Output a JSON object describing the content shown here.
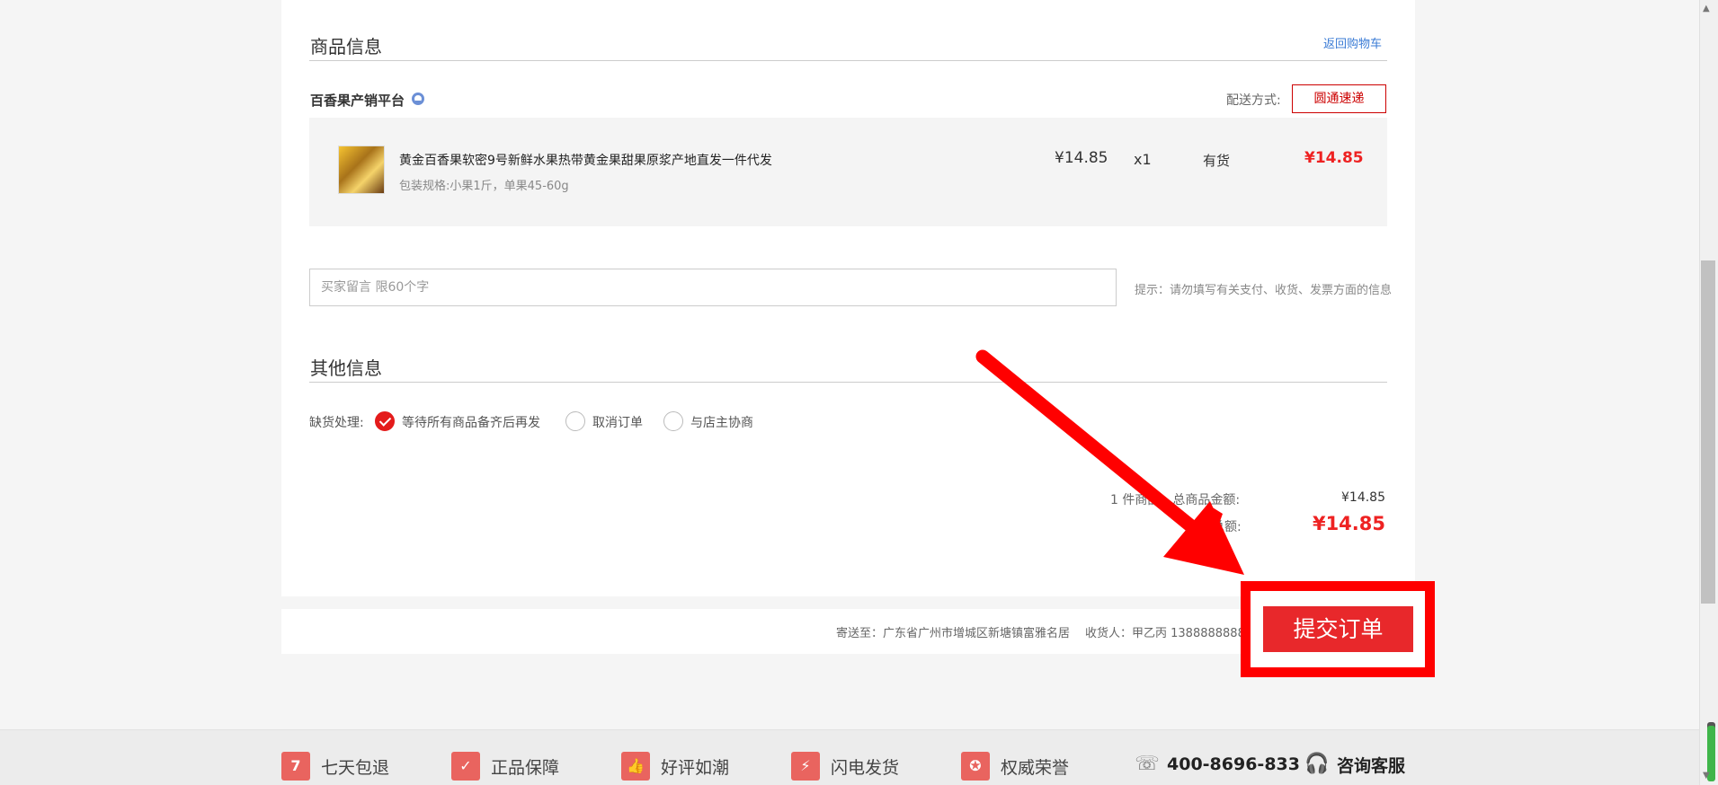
{
  "goods_section": {
    "title": "商品信息",
    "back_link": "返回购物车"
  },
  "shop": {
    "name": "百香果产销平台",
    "shipping_label": "配送方式:",
    "shipping_method": "圆通速递"
  },
  "product": {
    "title": "黄金百香果软密9号新鲜水果热带黄金果甜果原浆产地直发一件代发",
    "spec": "包装规格:小果1斤，单果45-60g",
    "price": "¥14.85",
    "quantity": "x1",
    "stock": "有货",
    "subtotal": "¥14.85"
  },
  "message": {
    "placeholder": "买家留言 限60个字",
    "tip": "提示：请勿填写有关支付、收货、发票方面的信息"
  },
  "other_section": {
    "title": "其他信息",
    "oos_label": "缺货处理:",
    "options": [
      {
        "label": "等待所有商品备齐后再发",
        "checked": true
      },
      {
        "label": "取消订单",
        "checked": false
      },
      {
        "label": "与店主协商",
        "checked": false
      }
    ]
  },
  "summary": {
    "count_text": "1 件商品，总商品金额:",
    "goods_total": "¥14.85",
    "payable_label": "应付总额:",
    "payable_total": "¥14.85"
  },
  "address_bar": {
    "ship_to": "寄送至：广东省广州市增城区新塘镇富雅名居",
    "receiver": "收货人：甲乙丙  13888888888"
  },
  "submit": {
    "label": "提交订单"
  },
  "footer": {
    "items": [
      {
        "icon": "seven-day-return-icon",
        "glyph": "7",
        "label": "七天包退"
      },
      {
        "icon": "shield-check-icon",
        "glyph": "✓",
        "label": "正品保障"
      },
      {
        "icon": "thumbs-up-icon",
        "glyph": "👍",
        "label": "好评如潮"
      },
      {
        "icon": "lightning-icon",
        "glyph": "⚡",
        "label": "闪电发货"
      },
      {
        "icon": "medal-icon",
        "glyph": "✪",
        "label": "权威荣誉"
      }
    ],
    "phone": "400-8696-833",
    "service": "咨询客服"
  },
  "colors": {
    "accent_red": "#e8282b",
    "highlight_red": "#ff0000",
    "link_blue": "#3a7bd5"
  }
}
